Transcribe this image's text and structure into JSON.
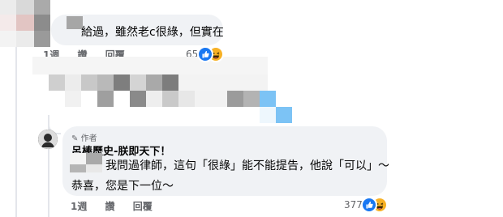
{
  "comment1": {
    "text": "給過，雖然老c很綠，但實在",
    "actions": {
      "time": "1週",
      "like": "讚",
      "reply": "回覆"
    },
    "reaction_count": "65"
  },
  "comment2": {
    "author_badge": "作者",
    "author_name": "呂棒歷史-朕即天下！",
    "text_line1": "我問過律師，這句「很綠」能不能提告，他說「可以」～",
    "text_line2": "恭喜，您是下一位～",
    "actions": {
      "time": "1週",
      "like": "讚",
      "reply": "回覆"
    },
    "reaction_count": "377"
  },
  "colors": {
    "bubble": "#f0f2f5",
    "secondary_text": "#65676b",
    "like_blue": "#1877f2",
    "haha_yellow": "#f7b125",
    "mosaic_blue": "#7cc3f5"
  }
}
